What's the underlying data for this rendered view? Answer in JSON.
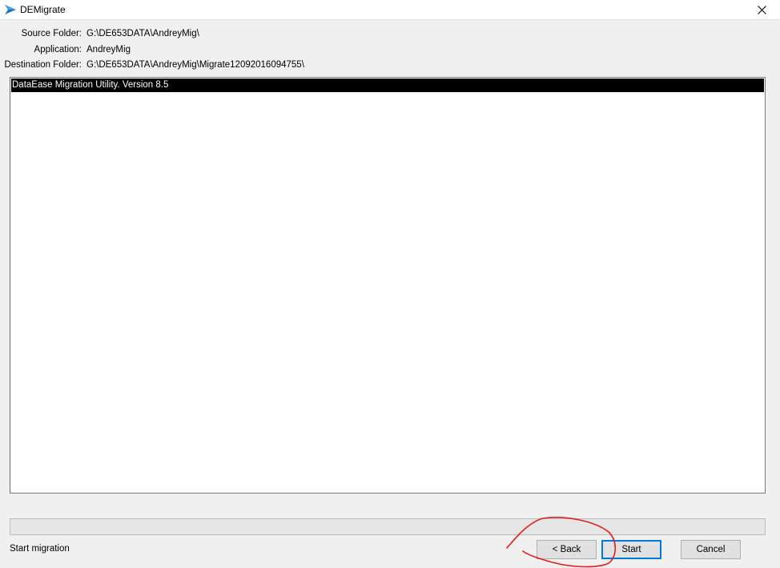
{
  "window": {
    "title": "DEMigrate",
    "app_icon": "bird-arrow-icon",
    "close_icon": "close-icon"
  },
  "info": {
    "source_label": "Source Folder:",
    "source_value": "G:\\DE653DATA\\AndreyMig\\",
    "application_label": "Application:",
    "application_value": "AndreyMig",
    "destination_label": "Destination Folder:",
    "destination_value": "G:\\DE653DATA\\AndreyMig\\Migrate12092016094755\\"
  },
  "log": {
    "lines": [
      "DataEase Migration Utility. Version 8.5"
    ],
    "selected_index": 0
  },
  "progress": {
    "value": 0
  },
  "status_text": "Start migration",
  "buttons": {
    "back": "< Back",
    "start": "Start",
    "cancel": "Cancel"
  },
  "colors": {
    "accent": "#0078d7",
    "annotation": "#e0201b",
    "selection": "#000000"
  }
}
